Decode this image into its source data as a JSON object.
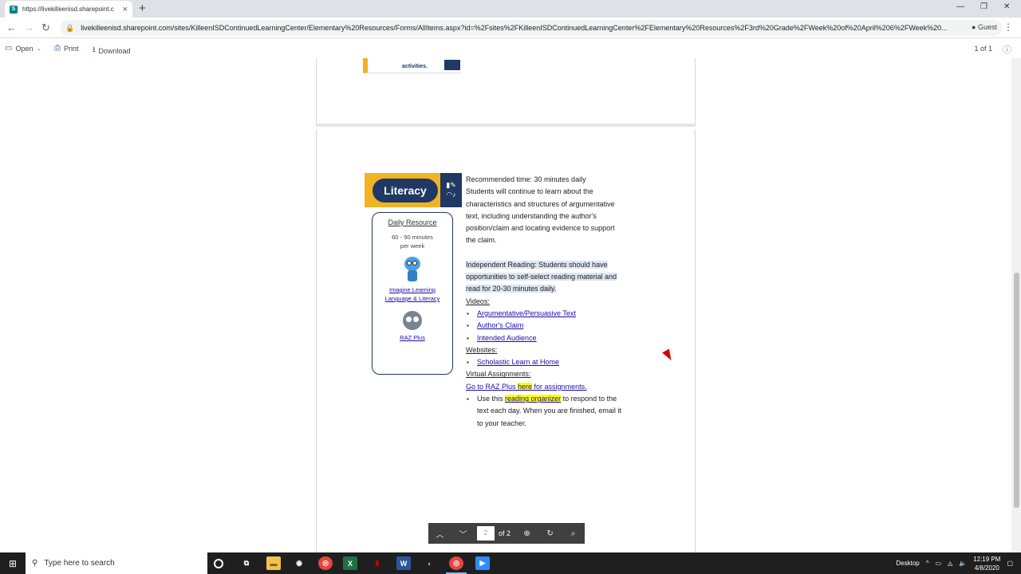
{
  "browser": {
    "tab_title": "https://livekilleenisd.sharepoint.c",
    "url": "livekilleenisd.sharepoint.com/sites/KilleenISDContinuedLearningCenter/Elementary%20Resources/Forms/AllItems.aspx?id=%2Fsites%2FKilleenISDContinuedLearningCenter%2FElementary%20Resources%2F3rd%20Grade%2FWeek%20of%20April%206%2FWeek%20...",
    "profile_label": "Guest"
  },
  "toolbar": {
    "open_label": "Open",
    "print_label": "Print",
    "download_label": "Download",
    "page_count": "1 of 1"
  },
  "page1": {
    "banner_snippet": "activities."
  },
  "literacy": {
    "banner_label": "Literacy",
    "resource_box": {
      "title": "Daily Resource",
      "frequency_line1": "60 - 90 minutes",
      "frequency_line2": "per week",
      "resource1_line1": "Imagine Learning",
      "resource1_line2": "Language & Literacy",
      "resource2": "RAZ Plus"
    },
    "content": {
      "recommended_time": "Recommended time: 30 minutes daily",
      "description_lines": [
        "Students will continue to learn about the",
        "characteristics and structures of argumentative",
        "text, including understanding the author's",
        "position/claim and locating evidence to support",
        "the claim."
      ],
      "independent_reading_lines": [
        "Independent Reading:  Students should have",
        "opportunities to self-select reading material and",
        "read for 20-30 minutes daily."
      ],
      "videos_heading": "Videos:",
      "videos": [
        "Argumentative/Persuasive Text",
        "Author's Claim",
        "Intended Audience"
      ],
      "websites_heading": "Websites:",
      "websites": [
        "Scholastic Learn at Home"
      ],
      "virtual_heading": "Virtual Assignments:",
      "raz_link_before": "Go to RAZ Plus ",
      "raz_link_here": "here",
      "raz_link_after": " for assignments.",
      "task_before": "Use this ",
      "task_link": "reading organizer",
      "task_after_line1": " to respond to the",
      "task_line2": "text each day.  When you are finished, email it",
      "task_line3": "to your teacher."
    }
  },
  "pdf_controls": {
    "current_page": "2",
    "of_pages": "of 2"
  },
  "taskbar": {
    "search_placeholder": "Type here to search",
    "desktop_label": "Desktop",
    "time": "12:19 PM",
    "date": "4/8/2020"
  }
}
